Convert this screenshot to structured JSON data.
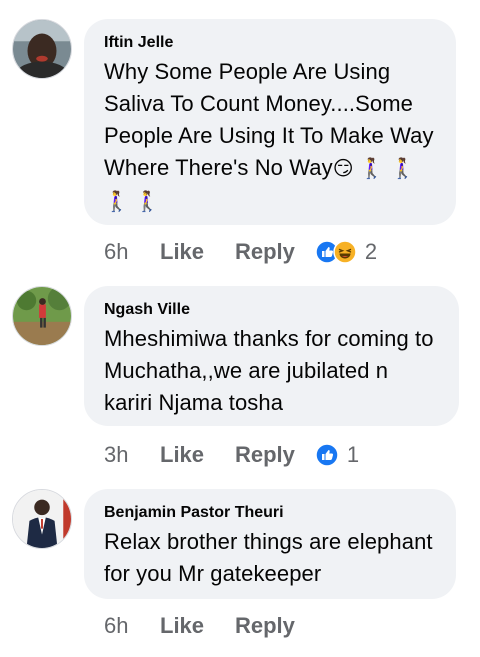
{
  "comments": [
    {
      "author": "Iftin Jelle",
      "text": "Why Some People Are Using Saliva To Count Money....Some People Are Using It To Make Way Where There's No Way",
      "emojis": "😏 🚶‍♀️ 🚶‍♀️ 🚶‍♀️ 🚶‍♀️",
      "time": "6h",
      "like_label": "Like",
      "reply_label": "Reply",
      "reactions": [
        "like-icon",
        "haha-icon"
      ],
      "reaction_count": "2"
    },
    {
      "author": "Ngash Ville",
      "text": "Mheshimiwa thanks for coming to Muchatha,,we are jubilated n kariri Njama tosha",
      "time": "3h",
      "like_label": "Like",
      "reply_label": "Reply",
      "reactions": [
        "like-icon"
      ],
      "reaction_count": "1"
    },
    {
      "author": "Benjamin Pastor Theuri",
      "text": "Relax brother things are elephant for you Mr gatekeeper",
      "time": "6h",
      "like_label": "Like",
      "reply_label": "Reply"
    }
  ],
  "colors": {
    "bubble": "#f0f2f5",
    "meta_text": "#65676b",
    "like_blue": "#1877f2",
    "haha_yellow": "#f7b125"
  }
}
